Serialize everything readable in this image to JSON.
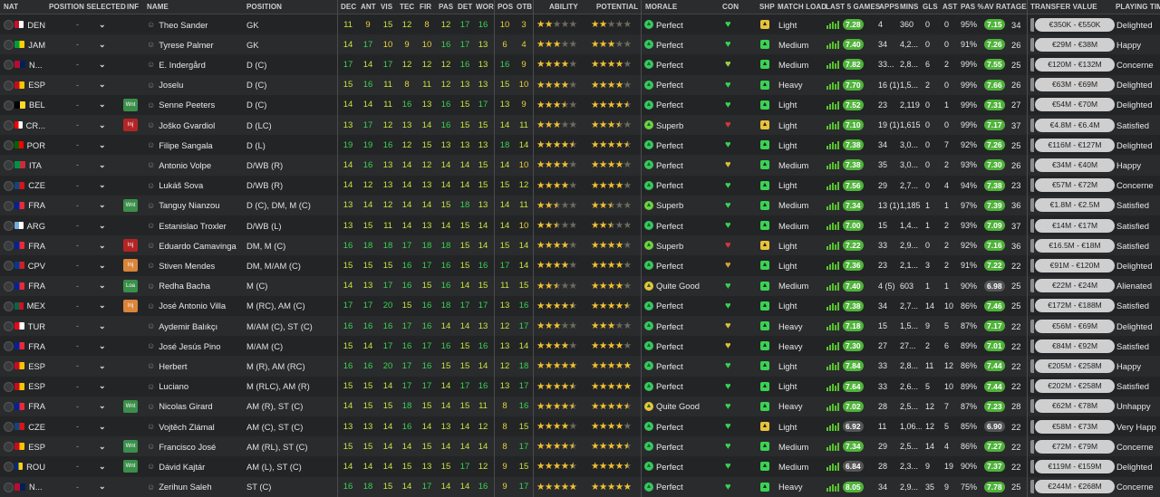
{
  "headers": {
    "nat": "NAT",
    "position_selected": "POSITION SELECTED",
    "inf": "INF",
    "name": "NAME",
    "position": "POSITION",
    "dec": "DEC",
    "ant": "ANT",
    "vis": "VIS",
    "tec": "TEC",
    "fir": "FIR",
    "pas": "PAS",
    "det": "DET",
    "wor": "WOR",
    "pos": "POS",
    "otb": "OTB",
    "ability": "ABILITY",
    "potential": "POTENTIAL",
    "morale": "MORALE",
    "con": "CON",
    "shp": "SHP",
    "match_load": "MATCH LOAD",
    "last5": "LAST 5 GAMES",
    "apps": "APPS",
    "mins": "MINS",
    "gls": "GLS",
    "ast": "AST",
    "pas_pct": "PAS %",
    "av_rat": "AV RAT",
    "age": "AGE",
    "transfer_value": "TRANSFER VALUE",
    "playing_time": "PLAYING TIM"
  },
  "colors": {
    "green_attr": "#c8e53e",
    "bright_green": "#39d353",
    "yellow_attr": "#e8d23a",
    "inf_wnt": "#3a8f4a",
    "inf_inj": "#b32525",
    "inf_orange": "#d9853a",
    "morale_perfect": "#37c85f",
    "morale_superb": "#6fd23f",
    "morale_good": "#e6c53a",
    "rating_green": "#4fb33a"
  },
  "rows": [
    {
      "nat": "DEN",
      "flag": [
        "#c8102e",
        "#ffffff"
      ],
      "dash": "-",
      "inf": "",
      "name": "Theo Sander",
      "position": "GK",
      "dec": "11",
      "ant": "9",
      "vis": "15",
      "tec": "12",
      "fir": "8",
      "pas": "12",
      "det": "17",
      "wor": "16",
      "pos": "10",
      "otb": "3",
      "ability": 2,
      "potential": 2,
      "morale": "Perfect",
      "con": "#39d353",
      "shp": "#e8c33a",
      "load": "Light",
      "last5": "7.28",
      "apps": "4",
      "mins": "360",
      "gls": "0",
      "ast": "0",
      "paspct": "95%",
      "avrat": "7.15",
      "age": "34",
      "tv": "€350K - €550K",
      "pt": "Delighted"
    },
    {
      "nat": "JAM",
      "flag": [
        "#009b3a",
        "#fed100"
      ],
      "dash": "-",
      "inf": "",
      "name": "Tyrese Palmer",
      "position": "GK",
      "dec": "14",
      "ant": "17",
      "vis": "10",
      "tec": "9",
      "fir": "10",
      "pas": "16",
      "det": "17",
      "wor": "13",
      "pos": "6",
      "otb": "4",
      "ability": 3,
      "potential": 3,
      "morale": "Perfect",
      "con": "#39d353",
      "shp": "#39d353",
      "load": "Medium",
      "last5": "7.40",
      "apps": "34",
      "mins": "4,2...",
      "gls": "0",
      "ast": "0",
      "paspct": "91%",
      "avrat": "7.26",
      "age": "26",
      "tv": "€29M - €38M",
      "pt": "Happy"
    },
    {
      "nat": "N...",
      "flag": [
        "#ba0c2f",
        "#00205b"
      ],
      "dash": "-",
      "inf": "",
      "name": "E. Indergård",
      "position": "D (C)",
      "dec": "17",
      "ant": "14",
      "vis": "17",
      "tec": "12",
      "fir": "12",
      "pas": "12",
      "det": "16",
      "wor": "13",
      "pos": "16",
      "otb": "9",
      "ability": 4,
      "potential": 4,
      "morale": "Perfect",
      "con": "#9bd64a",
      "shp": "#39d353",
      "load": "Medium",
      "last5": "7.82",
      "apps": "33...",
      "mins": "2,8...",
      "gls": "6",
      "ast": "2",
      "paspct": "99%",
      "avrat": "7.55",
      "age": "25",
      "tv": "€120M - €132M",
      "pt": "Concerne"
    },
    {
      "nat": "ESP",
      "flag": [
        "#c60b1e",
        "#ffc400"
      ],
      "dash": "-",
      "inf": "",
      "name": "Joselu",
      "position": "D (C)",
      "dec": "15",
      "ant": "16",
      "vis": "11",
      "tec": "8",
      "fir": "11",
      "pas": "12",
      "det": "13",
      "wor": "13",
      "pos": "15",
      "otb": "10",
      "ability": 4,
      "potential": 4,
      "morale": "Perfect",
      "con": "#39d353",
      "shp": "#39d353",
      "load": "Heavy",
      "last5": "7.70",
      "apps": "16 (1)",
      "mins": "1,5...",
      "gls": "2",
      "ast": "0",
      "paspct": "99%",
      "avrat": "7.66",
      "age": "26",
      "tv": "€63M - €69M",
      "pt": "Delighted"
    },
    {
      "nat": "BEL",
      "flag": [
        "#000000",
        "#fdda24"
      ],
      "dash": "-",
      "inf": "Wnt",
      "infc": "inf_wnt",
      "name": "Senne Peeters",
      "position": "D (C)",
      "dec": "14",
      "ant": "14",
      "vis": "11",
      "tec": "16",
      "fir": "13",
      "pas": "16",
      "det": "15",
      "wor": "17",
      "pos": "13",
      "otb": "9",
      "ability": 3.5,
      "potential": 4.5,
      "morale": "Perfect",
      "con": "#39d353",
      "shp": "#39d353",
      "load": "Light",
      "last5": "7.52",
      "apps": "23",
      "mins": "2,119",
      "gls": "0",
      "ast": "1",
      "paspct": "99%",
      "avrat": "7.31",
      "age": "27",
      "tv": "€54M - €70M",
      "pt": "Delighted"
    },
    {
      "nat": "CR...",
      "flag": [
        "#ff0000",
        "#ffffff"
      ],
      "dash": "-",
      "inf": "Inj",
      "infc": "inf_inj",
      "name": "Joško Gvardiol",
      "position": "D (LC)",
      "dec": "13",
      "ant": "17",
      "vis": "12",
      "tec": "13",
      "fir": "14",
      "pas": "16",
      "det": "15",
      "wor": "15",
      "pos": "14",
      "otb": "11",
      "ability": 3,
      "potential": 3.5,
      "morale": "Superb",
      "con": "#d9363e",
      "shp": "#e8c33a",
      "load": "Light",
      "last5": "7.10",
      "apps": "19 (1)",
      "mins": "1,615",
      "gls": "0",
      "ast": "0",
      "paspct": "99%",
      "avrat": "7.17",
      "age": "37",
      "tv": "€4.8M - €6.4M",
      "pt": "Satisfied"
    },
    {
      "nat": "POR",
      "flag": [
        "#006600",
        "#ff0000"
      ],
      "dash": "-",
      "inf": "",
      "name": "Filipe Sangala",
      "position": "D (L)",
      "dec": "19",
      "ant": "19",
      "vis": "16",
      "tec": "12",
      "fir": "15",
      "pas": "13",
      "det": "13",
      "wor": "13",
      "pos": "18",
      "otb": "14",
      "ability": 4.5,
      "potential": 4.5,
      "morale": "Perfect",
      "con": "#39d353",
      "shp": "#39d353",
      "load": "Light",
      "last5": "7.38",
      "apps": "34",
      "mins": "3,0...",
      "gls": "0",
      "ast": "7",
      "paspct": "92%",
      "avrat": "7.26",
      "age": "25",
      "tv": "€116M - €127M",
      "pt": "Delighted"
    },
    {
      "nat": "ITA",
      "flag": [
        "#009246",
        "#ce2b37"
      ],
      "dash": "-",
      "inf": "",
      "name": "Antonio Volpe",
      "position": "D/WB (R)",
      "dec": "14",
      "ant": "16",
      "vis": "13",
      "tec": "14",
      "fir": "12",
      "pas": "14",
      "det": "14",
      "wor": "15",
      "pos": "14",
      "otb": "10",
      "ability": 4,
      "potential": 4,
      "morale": "Perfect",
      "con": "#d8c43a",
      "shp": "#39d353",
      "load": "Medium",
      "last5": "7.38",
      "apps": "35",
      "mins": "3,0...",
      "gls": "0",
      "ast": "2",
      "paspct": "93%",
      "avrat": "7.30",
      "age": "26",
      "tv": "€34M - €40M",
      "pt": "Happy"
    },
    {
      "nat": "CZE",
      "flag": [
        "#11457e",
        "#d7141a"
      ],
      "dash": "-",
      "inf": "",
      "name": "Lukáš Sova",
      "position": "D/WB (R)",
      "dec": "14",
      "ant": "12",
      "vis": "13",
      "tec": "14",
      "fir": "13",
      "pas": "14",
      "det": "14",
      "wor": "15",
      "pos": "15",
      "otb": "12",
      "ability": 4,
      "potential": 4,
      "morale": "Perfect",
      "con": "#39d353",
      "shp": "#39d353",
      "load": "Light",
      "last5": "7.56",
      "apps": "29",
      "mins": "2,7...",
      "gls": "0",
      "ast": "4",
      "paspct": "94%",
      "avrat": "7.38",
      "age": "23",
      "tv": "€57M - €72M",
      "pt": "Concerne"
    },
    {
      "nat": "FRA",
      "flag": [
        "#002395",
        "#ed2939"
      ],
      "dash": "-",
      "inf": "Wnt",
      "infc": "inf_wnt",
      "name": "Tanguy Nianzou",
      "position": "D (C), DM, M (C)",
      "dec": "13",
      "ant": "14",
      "vis": "12",
      "tec": "14",
      "fir": "14",
      "pas": "15",
      "det": "18",
      "wor": "13",
      "pos": "14",
      "otb": "11",
      "ability": 2.5,
      "potential": 2.5,
      "morale": "Superb",
      "con": "#39d353",
      "shp": "#39d353",
      "load": "Medium",
      "last5": "7.34",
      "apps": "13 (1)",
      "mins": "1,185",
      "gls": "1",
      "ast": "1",
      "paspct": "97%",
      "avrat": "7.39",
      "age": "36",
      "tv": "€1.8M - €2.5M",
      "pt": "Satisfied"
    },
    {
      "nat": "ARG",
      "flag": [
        "#74acdf",
        "#ffffff"
      ],
      "dash": "-",
      "inf": "",
      "name": "Estanislao Troxler",
      "position": "D/WB (L)",
      "dec": "13",
      "ant": "15",
      "vis": "11",
      "tec": "14",
      "fir": "13",
      "pas": "14",
      "det": "15",
      "wor": "14",
      "pos": "14",
      "otb": "10",
      "ability": 2.5,
      "potential": 2.5,
      "morale": "Perfect",
      "con": "#39d353",
      "shp": "#39d353",
      "load": "Medium",
      "last5": "7.00",
      "apps": "15",
      "mins": "1,4...",
      "gls": "1",
      "ast": "2",
      "paspct": "93%",
      "avrat": "7.09",
      "age": "37",
      "tv": "€14M - €17M",
      "pt": "Satisfied"
    },
    {
      "nat": "FRA",
      "flag": [
        "#002395",
        "#ed2939"
      ],
      "dash": "-",
      "inf": "Inj",
      "infc": "inf_inj",
      "name": "Eduardo Camavinga",
      "position": "DM, M (C)",
      "dec": "16",
      "ant": "18",
      "vis": "18",
      "tec": "17",
      "fir": "18",
      "pas": "18",
      "det": "15",
      "wor": "14",
      "pos": "15",
      "otb": "14",
      "ability": 4,
      "potential": 4,
      "morale": "Superb",
      "con": "#d9363e",
      "shp": "#e8c33a",
      "load": "Light",
      "last5": "7.22",
      "apps": "33",
      "mins": "2,9...",
      "gls": "0",
      "ast": "2",
      "paspct": "92%",
      "avrat": "7.16",
      "age": "36",
      "tv": "€16.5M - €18M",
      "pt": "Satisfied"
    },
    {
      "nat": "CPV",
      "flag": [
        "#003893",
        "#cf2027"
      ],
      "dash": "-",
      "inf": "Inj",
      "infc": "inf_orange",
      "name": "Stiven Mendes",
      "position": "DM, M/AM (C)",
      "dec": "15",
      "ant": "15",
      "vis": "15",
      "tec": "16",
      "fir": "17",
      "pas": "16",
      "det": "15",
      "wor": "16",
      "pos": "17",
      "otb": "14",
      "ability": 4,
      "potential": 4,
      "morale": "Perfect",
      "con": "#d8a23a",
      "shp": "#39d353",
      "load": "Light",
      "last5": "7.36",
      "apps": "23",
      "mins": "2,1...",
      "gls": "3",
      "ast": "2",
      "paspct": "91%",
      "avrat": "7.22",
      "age": "22",
      "tv": "€91M - €120M",
      "pt": "Delighted"
    },
    {
      "nat": "FRA",
      "flag": [
        "#002395",
        "#ed2939"
      ],
      "dash": "-",
      "inf": "Loa",
      "infc": "inf_wnt",
      "name": "Redha Bacha",
      "position": "M (C)",
      "dec": "14",
      "ant": "13",
      "vis": "17",
      "tec": "16",
      "fir": "15",
      "pas": "16",
      "det": "14",
      "wor": "15",
      "pos": "11",
      "otb": "15",
      "ability": 2.5,
      "potential": 4,
      "morale": "Quite Good",
      "con": "#39d353",
      "shp": "#39d353",
      "load": "Medium",
      "last5": "7.40",
      "apps": "4 (5)",
      "mins": "603",
      "gls": "1",
      "ast": "1",
      "paspct": "90%",
      "avrat": "6.98",
      "age": "25",
      "tv": "€22M - €24M",
      "pt": "Alienated"
    },
    {
      "nat": "MEX",
      "flag": [
        "#006847",
        "#ce1126"
      ],
      "dash": "-",
      "inf": "Inj",
      "infc": "inf_orange",
      "name": "José Antonio Villa",
      "position": "M (RC), AM (C)",
      "dec": "17",
      "ant": "17",
      "vis": "20",
      "tec": "15",
      "fir": "16",
      "pas": "18",
      "det": "17",
      "wor": "17",
      "pos": "13",
      "otb": "16",
      "ability": 4.5,
      "potential": 4.5,
      "morale": "Perfect",
      "con": "#39d353",
      "shp": "#39d353",
      "load": "Light",
      "last5": "7.38",
      "apps": "34",
      "mins": "2,7...",
      "gls": "14",
      "ast": "10",
      "paspct": "86%",
      "avrat": "7.46",
      "age": "25",
      "tv": "€172M - €188M",
      "pt": "Satisfied"
    },
    {
      "nat": "TUR",
      "flag": [
        "#e30a17",
        "#ffffff"
      ],
      "dash": "-",
      "inf": "",
      "name": "Aydemir Balıkçı",
      "position": "M/AM (C), ST (C)",
      "dec": "16",
      "ant": "16",
      "vis": "16",
      "tec": "17",
      "fir": "16",
      "pas": "14",
      "det": "14",
      "wor": "13",
      "pos": "12",
      "otb": "17",
      "ability": 3,
      "potential": 3,
      "morale": "Perfect",
      "con": "#d8c43a",
      "shp": "#39d353",
      "load": "Heavy",
      "last5": "7.18",
      "apps": "15",
      "mins": "1,5...",
      "gls": "9",
      "ast": "5",
      "paspct": "87%",
      "avrat": "7.17",
      "age": "22",
      "tv": "€56M - €69M",
      "pt": "Delighted"
    },
    {
      "nat": "FRA",
      "flag": [
        "#002395",
        "#ed2939"
      ],
      "dash": "-",
      "inf": "",
      "name": "José Jesús Pino",
      "position": "M/AM (C)",
      "dec": "15",
      "ant": "14",
      "vis": "17",
      "tec": "16",
      "fir": "17",
      "pas": "16",
      "det": "15",
      "wor": "16",
      "pos": "13",
      "otb": "14",
      "ability": 4,
      "potential": 4,
      "morale": "Perfect",
      "con": "#d8c43a",
      "shp": "#39d353",
      "load": "Heavy",
      "last5": "7.30",
      "apps": "27",
      "mins": "27...",
      "gls": "2",
      "ast": "6",
      "paspct": "89%",
      "avrat": "7.01",
      "age": "22",
      "tv": "€84M - €92M",
      "pt": "Satisfied"
    },
    {
      "nat": "ESP",
      "flag": [
        "#c60b1e",
        "#ffc400"
      ],
      "dash": "-",
      "inf": "",
      "name": "Herbert",
      "position": "M (R), AM (RC)",
      "dec": "16",
      "ant": "16",
      "vis": "20",
      "tec": "17",
      "fir": "16",
      "pas": "15",
      "det": "15",
      "wor": "14",
      "pos": "12",
      "otb": "18",
      "ability": 5,
      "potential": 5,
      "morale": "Perfect",
      "con": "#39d353",
      "shp": "#39d353",
      "load": "Light",
      "last5": "7.84",
      "apps": "33",
      "mins": "2,8...",
      "gls": "11",
      "ast": "12",
      "paspct": "86%",
      "avrat": "7.44",
      "age": "22",
      "tv": "€205M - €258M",
      "pt": "Happy"
    },
    {
      "nat": "ESP",
      "flag": [
        "#c60b1e",
        "#ffc400"
      ],
      "dash": "-",
      "inf": "",
      "name": "Luciano",
      "position": "M (RLC), AM (R)",
      "dec": "15",
      "ant": "15",
      "vis": "14",
      "tec": "17",
      "fir": "17",
      "pas": "14",
      "det": "17",
      "wor": "16",
      "pos": "13",
      "otb": "17",
      "ability": 4.5,
      "potential": 5,
      "morale": "Perfect",
      "con": "#39d353",
      "shp": "#39d353",
      "load": "Light",
      "last5": "7.64",
      "apps": "33",
      "mins": "2,6...",
      "gls": "5",
      "ast": "10",
      "paspct": "89%",
      "avrat": "7.44",
      "age": "22",
      "tv": "€202M - €258M",
      "pt": "Satisfied"
    },
    {
      "nat": "FRA",
      "flag": [
        "#002395",
        "#ed2939"
      ],
      "dash": "-",
      "inf": "Wnt",
      "infc": "inf_wnt",
      "name": "Nicolas Girard",
      "position": "AM (R), ST (C)",
      "dec": "14",
      "ant": "15",
      "vis": "15",
      "tec": "18",
      "fir": "15",
      "pas": "14",
      "det": "15",
      "wor": "11",
      "pos": "8",
      "otb": "16",
      "ability": 4.5,
      "potential": 4.5,
      "morale": "Quite Good",
      "con": "#39d353",
      "shp": "#39d353",
      "load": "Heavy",
      "last5": "7.02",
      "apps": "28",
      "mins": "2,5...",
      "gls": "12",
      "ast": "7",
      "paspct": "87%",
      "avrat": "7.23",
      "age": "28",
      "tv": "€62M - €78M",
      "pt": "Unhappy"
    },
    {
      "nat": "CZE",
      "flag": [
        "#11457e",
        "#d7141a"
      ],
      "dash": "-",
      "inf": "",
      "name": "Vojtěch Zlámal",
      "position": "AM (C), ST (C)",
      "dec": "13",
      "ant": "13",
      "vis": "14",
      "tec": "16",
      "fir": "14",
      "pas": "13",
      "det": "14",
      "wor": "12",
      "pos": "8",
      "otb": "15",
      "ability": 4,
      "potential": 4,
      "morale": "Perfect",
      "con": "#39d353",
      "shp": "#e8c33a",
      "load": "Light",
      "last5": "6.92",
      "apps": "11",
      "mins": "1,06...",
      "gls": "12",
      "ast": "5",
      "paspct": "85%",
      "avrat": "6.90",
      "age": "22",
      "tv": "€58M - €73M",
      "pt": "Very Happ"
    },
    {
      "nat": "ESP",
      "flag": [
        "#c60b1e",
        "#ffc400"
      ],
      "dash": "-",
      "inf": "Wnt",
      "infc": "inf_wnt",
      "name": "Francisco José",
      "position": "AM (RL), ST (C)",
      "dec": "15",
      "ant": "15",
      "vis": "14",
      "tec": "14",
      "fir": "15",
      "pas": "14",
      "det": "14",
      "wor": "14",
      "pos": "8",
      "otb": "17",
      "ability": 4.5,
      "potential": 4.5,
      "morale": "Perfect",
      "con": "#39d353",
      "shp": "#39d353",
      "load": "Medium",
      "last5": "7.34",
      "apps": "29",
      "mins": "2,5...",
      "gls": "14",
      "ast": "4",
      "paspct": "86%",
      "avrat": "7.27",
      "age": "22",
      "tv": "€72M - €79M",
      "pt": "Concerne"
    },
    {
      "nat": "ROU",
      "flag": [
        "#002b7f",
        "#fcd116"
      ],
      "dash": "-",
      "inf": "Wnt",
      "infc": "inf_wnt",
      "name": "Dávid Kajtár",
      "position": "AM (L), ST (C)",
      "dec": "14",
      "ant": "14",
      "vis": "14",
      "tec": "15",
      "fir": "13",
      "pas": "15",
      "det": "17",
      "wor": "12",
      "pos": "9",
      "otb": "15",
      "ability": 4.5,
      "potential": 4.5,
      "morale": "Perfect",
      "con": "#39d353",
      "shp": "#39d353",
      "load": "Medium",
      "last5": "6.84",
      "apps": "28",
      "mins": "2,3...",
      "gls": "9",
      "ast": "19",
      "paspct": "90%",
      "avrat": "7.37",
      "age": "22",
      "tv": "€119M - €159M",
      "pt": "Delighted"
    },
    {
      "nat": "N...",
      "flag": [
        "#ba0c2f",
        "#00205b"
      ],
      "dash": "-",
      "inf": "",
      "name": "Zerihun Saleh",
      "position": "ST (C)",
      "dec": "16",
      "ant": "18",
      "vis": "15",
      "tec": "14",
      "fir": "17",
      "pas": "14",
      "det": "14",
      "wor": "16",
      "pos": "9",
      "otb": "17",
      "ability": 5,
      "potential": 5,
      "morale": "Perfect",
      "con": "#39d353",
      "shp": "#39d353",
      "load": "Heavy",
      "last5": "8.05",
      "apps": "34",
      "mins": "2,9...",
      "gls": "35",
      "ast": "9",
      "paspct": "75%",
      "avrat": "7.78",
      "age": "25",
      "tv": "€244M - €268M",
      "pt": "Concerne"
    }
  ]
}
